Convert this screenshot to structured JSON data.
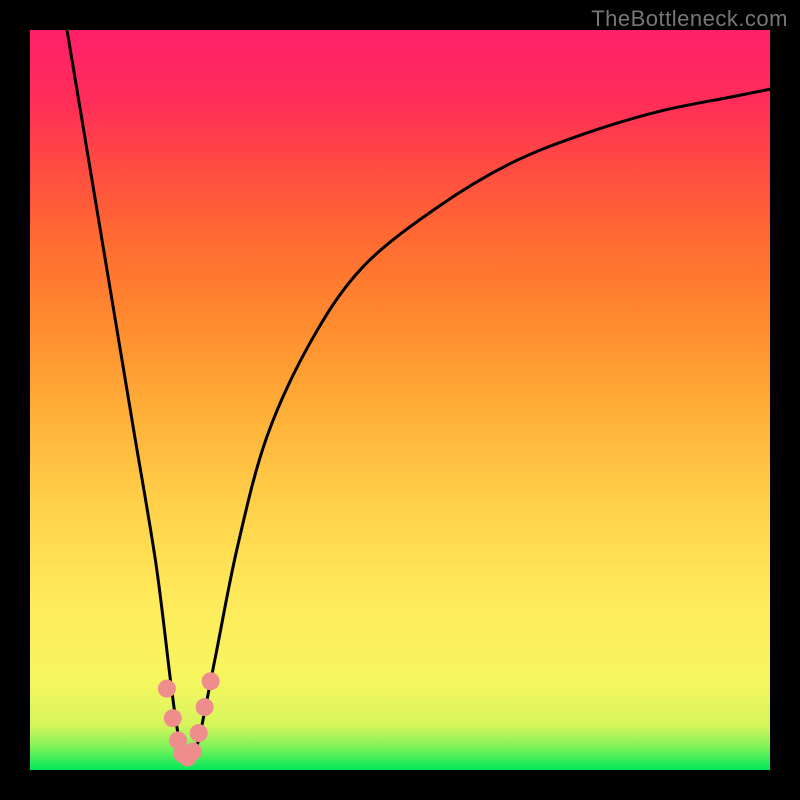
{
  "watermark": "TheBottleneck.com",
  "chart_data": {
    "type": "line",
    "title": "",
    "xlabel": "",
    "ylabel": "",
    "xlim": [
      0,
      100
    ],
    "ylim": [
      0,
      100
    ],
    "grid": false,
    "legend": false,
    "series": [
      {
        "name": "bottleneck-curve",
        "x": [
          5,
          8,
          11,
          14,
          17,
          19,
          20,
          21,
          22,
          23,
          25,
          28,
          32,
          38,
          45,
          55,
          65,
          75,
          85,
          95,
          100
        ],
        "y": [
          100,
          82,
          64,
          46,
          28,
          12,
          5,
          2,
          2,
          5,
          15,
          30,
          45,
          58,
          68,
          76,
          82,
          86,
          89,
          91,
          92
        ],
        "color": "#000000",
        "stroke_width": 3
      }
    ],
    "highlight_points": {
      "name": "near-minimum-dots",
      "color": "#ef8c8c",
      "radius": 9,
      "points": [
        {
          "x": 18.5,
          "y": 11
        },
        {
          "x": 19.3,
          "y": 7
        },
        {
          "x": 20.0,
          "y": 4
        },
        {
          "x": 20.6,
          "y": 2.2
        },
        {
          "x": 21.3,
          "y": 1.7
        },
        {
          "x": 22.0,
          "y": 2.5
        },
        {
          "x": 22.8,
          "y": 5
        },
        {
          "x": 23.6,
          "y": 8.5
        },
        {
          "x": 24.4,
          "y": 12
        }
      ]
    },
    "background_gradient_stops": [
      {
        "pos": 0,
        "color": "#00e85a"
      },
      {
        "pos": 3,
        "color": "#7af25a"
      },
      {
        "pos": 6,
        "color": "#d6f55c"
      },
      {
        "pos": 12,
        "color": "#f6f65f"
      },
      {
        "pos": 24,
        "color": "#ffe95a"
      },
      {
        "pos": 36,
        "color": "#ffd04a"
      },
      {
        "pos": 48,
        "color": "#ffb038"
      },
      {
        "pos": 60,
        "color": "#ff8c2f"
      },
      {
        "pos": 72,
        "color": "#ff6a32"
      },
      {
        "pos": 82,
        "color": "#ff4a43"
      },
      {
        "pos": 90,
        "color": "#ff2e58"
      },
      {
        "pos": 100,
        "color": "#ff1f6a"
      }
    ]
  }
}
